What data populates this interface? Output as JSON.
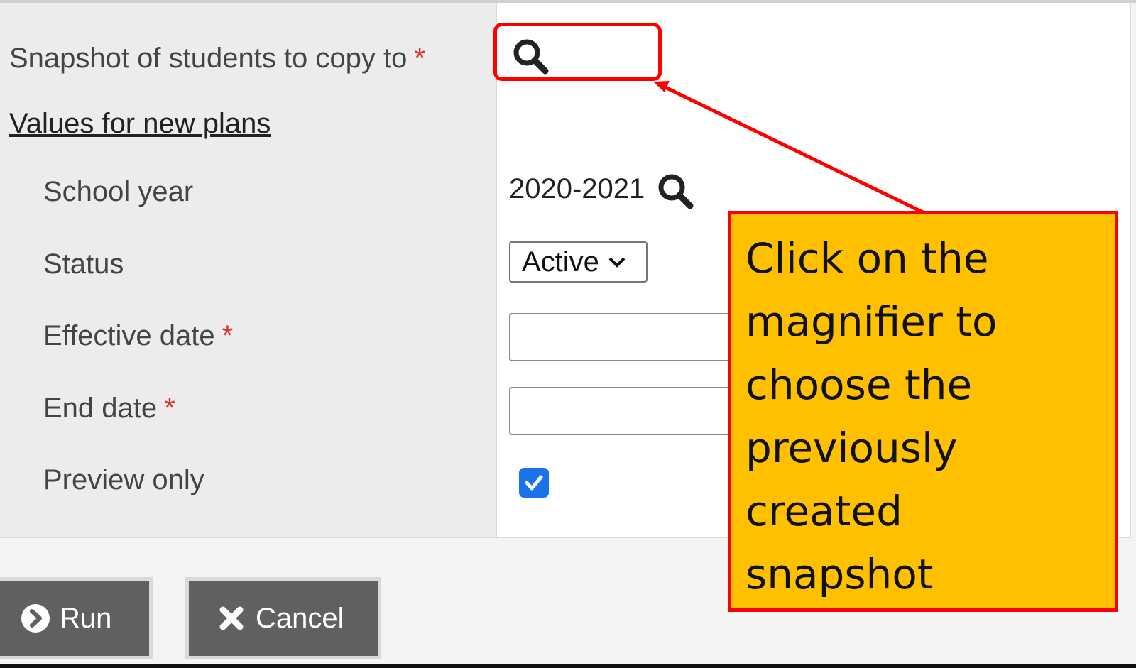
{
  "form": {
    "snapshot_label": "Snapshot of students to copy to",
    "required_mark": "*",
    "section_link": "Values for new plans",
    "school_year_label": "School year",
    "school_year_value": "2020-2021",
    "status_label": "Status",
    "status_value": "Active",
    "effective_date_label": "Effective date",
    "effective_date_value": "",
    "end_date_label": "End date",
    "end_date_value": "",
    "preview_only_label": "Preview only",
    "preview_only_checked": true
  },
  "buttons": {
    "run_label": "Run",
    "cancel_label": "Cancel"
  },
  "annotation": {
    "callout_line1": "Click on the",
    "callout_line2": "magnifier to",
    "callout_line3": "choose the",
    "callout_line4": "previously",
    "callout_line5": "created",
    "callout_line6": "snapshot",
    "box_color": "#ff0000",
    "callout_bg": "#ffc000"
  },
  "icons": {
    "snapshot_lookup": "magnifier-icon",
    "school_year_lookup": "magnifier-icon",
    "run": "chevron-circle-right-icon",
    "cancel": "x-icon",
    "status_dropdown": "chevron-down-icon",
    "checkbox": "checkmark-icon"
  }
}
